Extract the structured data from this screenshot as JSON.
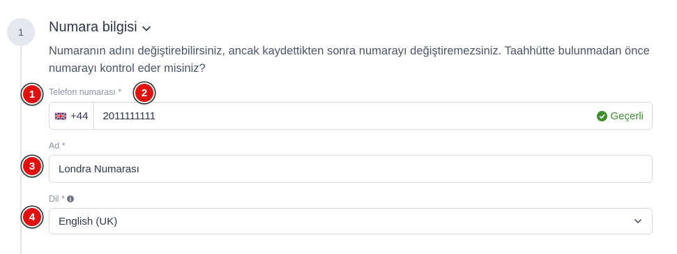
{
  "step": {
    "number": "1"
  },
  "section": {
    "title": "Numara bilgisi",
    "description": "Numaranın adını değiştirebilirsiniz, ancak kaydettikten sonra numarayı değiştiremezsiniz. Taahhütte bulunmadan önce numarayı kontrol eder misiniz?"
  },
  "phone": {
    "label": "Telefon numarası *",
    "country_flag": "uk-flag-icon",
    "dial_code": "+44",
    "value": "2011111111",
    "status": "Geçerli",
    "status_color": "#3e8e2e"
  },
  "name": {
    "label": "Ad *",
    "value": "Londra Numarası"
  },
  "language": {
    "label": "Dil *",
    "selected": "English (UK)"
  },
  "annotations": {
    "badge_1": "1",
    "badge_2": "2",
    "badge_3": "3",
    "badge_4": "4",
    "color": "#e0100f"
  }
}
